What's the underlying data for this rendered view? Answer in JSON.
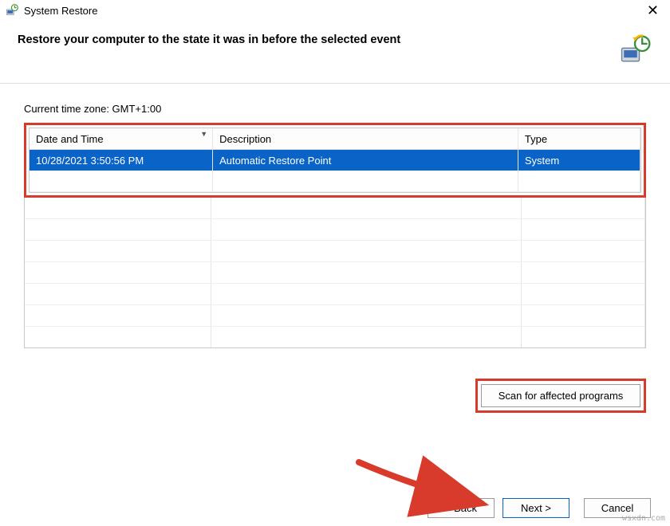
{
  "window": {
    "title": "System Restore"
  },
  "header": {
    "heading": "Restore your computer to the state it was in before the selected event"
  },
  "timezone_label": "Current time zone: GMT+1:00",
  "table": {
    "columns": {
      "date": "Date and Time",
      "desc": "Description",
      "type": "Type"
    },
    "rows": [
      {
        "date": "10/28/2021 3:50:56 PM",
        "desc": "Automatic Restore Point",
        "type": "System",
        "selected": true
      }
    ]
  },
  "buttons": {
    "scan": "Scan for affected programs",
    "back": "< Back",
    "next": "Next >",
    "cancel": "Cancel"
  },
  "watermark": "wsxdn.com"
}
